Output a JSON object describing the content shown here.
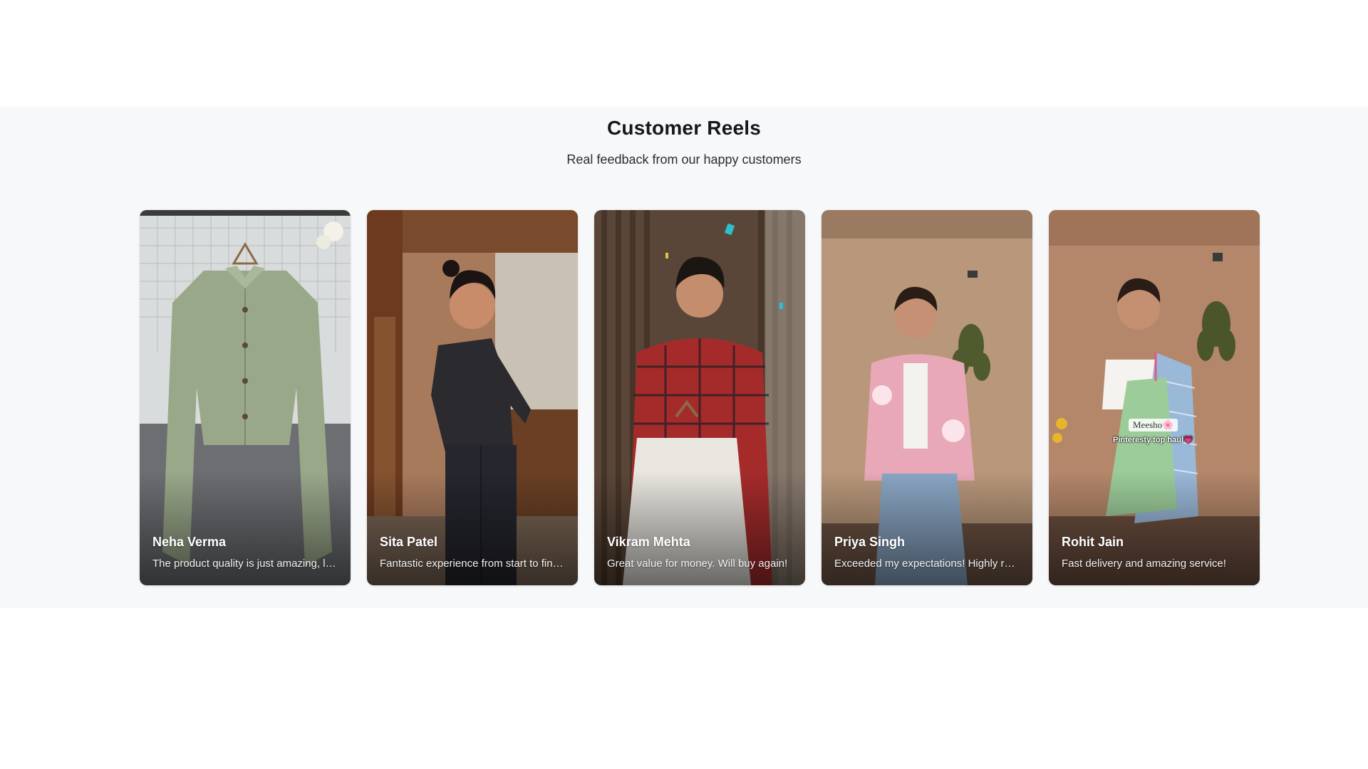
{
  "section": {
    "title": "Customer Reels",
    "subtitle": "Real feedback from our happy customers"
  },
  "reels": [
    {
      "name": "Neha Verma",
      "text": "The product quality is just amazing, loved it!",
      "scene": "sage-green-shirt-on-hanger"
    },
    {
      "name": "Sita Patel",
      "text": "Fantastic experience from start to finish!",
      "scene": "woman-black-top-jeans"
    },
    {
      "name": "Vikram Mehta",
      "text": "Great value for money. Will buy again!",
      "scene": "man-plaid-shirt-holding-shirts"
    },
    {
      "name": "Priya Singh",
      "text": "Exceeded my expectations! Highly recommend.",
      "scene": "woman-pink-floral-shirt"
    },
    {
      "name": "Rohit Jain",
      "text": "Fast delivery and amazing service!",
      "scene": "woman-holding-dresses-haul",
      "overlay_tag": "Meesho🌸",
      "overlay_caption": "Pinteresty top haul💗"
    }
  ]
}
